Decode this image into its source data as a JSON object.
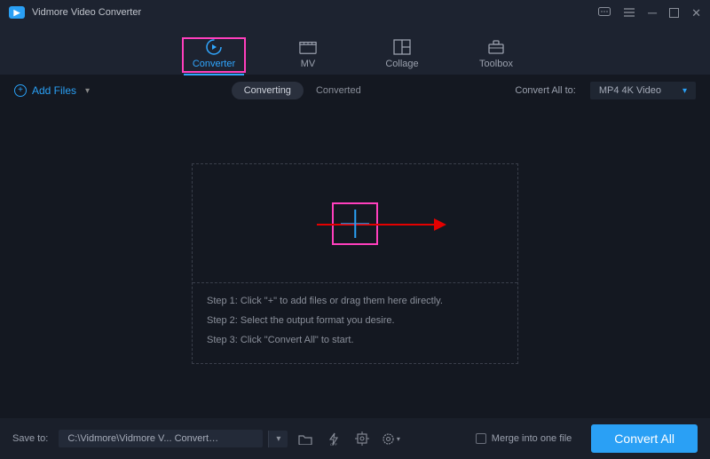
{
  "app_title": "Vidmore Video Converter",
  "tabs": {
    "converter": "Converter",
    "mv": "MV",
    "collage": "Collage",
    "toolbox": "Toolbox"
  },
  "subbar": {
    "add_files": "Add Files",
    "seg_converting": "Converting",
    "seg_converted": "Converted",
    "convert_all_to": "Convert All to:",
    "format_selected": "MP4 4K Video"
  },
  "steps": {
    "s1": "Step 1: Click \"+\" to add files or drag them here directly.",
    "s2": "Step 2: Select the output format you desire.",
    "s3": "Step 3: Click \"Convert All\" to start."
  },
  "bottom": {
    "save_to": "Save to:",
    "path": "C:\\Vidmore\\Vidmore V... Converter\\Converted",
    "merge": "Merge into one file",
    "convert_all": "Convert All"
  }
}
